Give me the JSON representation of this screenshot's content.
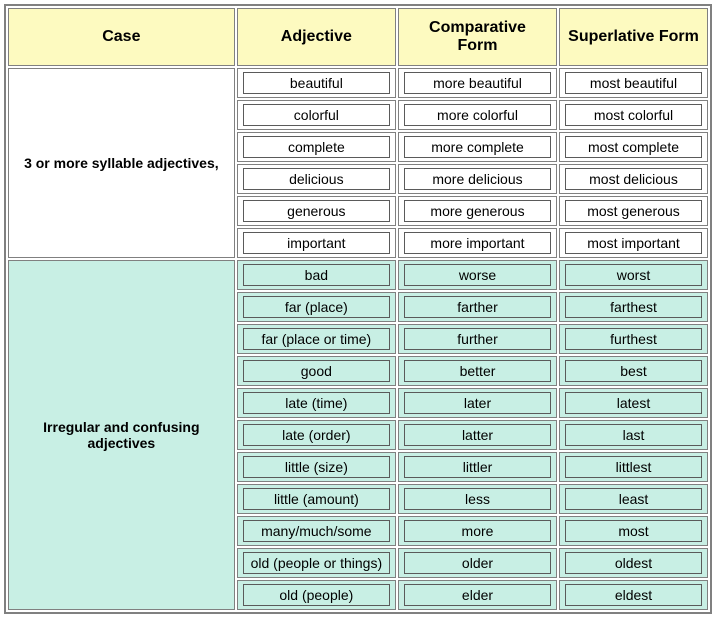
{
  "headers": {
    "case": "Case",
    "adjective": "Adjective",
    "comparative": "Comparative Form",
    "superlative": "Superlative Form"
  },
  "sections": [
    {
      "case_label": "3 or more syllable adjectives,",
      "bg": "white",
      "rows": [
        {
          "adj": "beautiful",
          "comp": "more beautiful",
          "sup": "most beautiful"
        },
        {
          "adj": "colorful",
          "comp": "more colorful",
          "sup": "most colorful"
        },
        {
          "adj": "complete",
          "comp": "more complete",
          "sup": "most complete"
        },
        {
          "adj": "delicious",
          "comp": "more delicious",
          "sup": "most delicious"
        },
        {
          "adj": "generous",
          "comp": "more generous",
          "sup": "most generous"
        },
        {
          "adj": "important",
          "comp": "more important",
          "sup": "most important"
        }
      ]
    },
    {
      "case_label": "Irregular and confusing adjectives",
      "bg": "green",
      "rows": [
        {
          "adj": "bad",
          "comp": "worse",
          "sup": "worst"
        },
        {
          "adj": "far (place)",
          "comp": "farther",
          "sup": "farthest"
        },
        {
          "adj": "far (place or time)",
          "comp": "further",
          "sup": "furthest"
        },
        {
          "adj": "good",
          "comp": "better",
          "sup": "best"
        },
        {
          "adj": "late (time)",
          "comp": "later",
          "sup": "latest"
        },
        {
          "adj": "late (order)",
          "comp": "latter",
          "sup": "last"
        },
        {
          "adj": "little (size)",
          "comp": "littler",
          "sup": "littlest"
        },
        {
          "adj": "little (amount)",
          "comp": "less",
          "sup": "least"
        },
        {
          "adj": "many/much/some",
          "comp": "more",
          "sup": "most"
        },
        {
          "adj": "old (people or things)",
          "comp": "older",
          "sup": "oldest"
        },
        {
          "adj": "old (people)",
          "comp": "elder",
          "sup": "eldest"
        }
      ]
    }
  ]
}
